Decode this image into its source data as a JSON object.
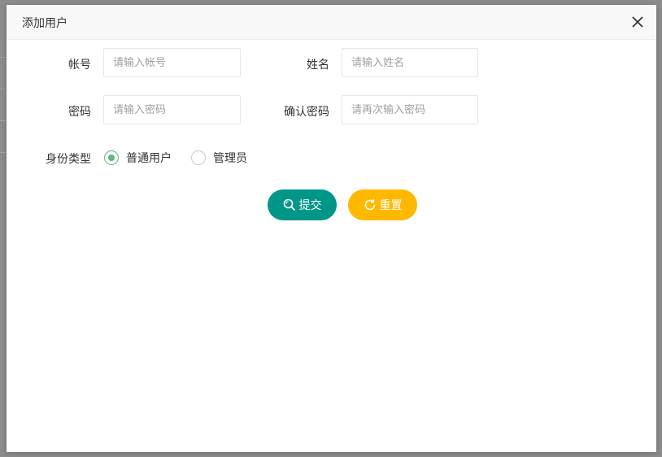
{
  "dialog": {
    "title": "添加用户",
    "close_icon": "close-icon"
  },
  "form": {
    "account": {
      "label": "帐号",
      "placeholder": "请输入帐号",
      "value": ""
    },
    "name": {
      "label": "姓名",
      "placeholder": "请输入姓名",
      "value": ""
    },
    "password": {
      "label": "密码",
      "placeholder": "请输入密码",
      "value": ""
    },
    "confirm_password": {
      "label": "确认密码",
      "placeholder": "请再次输入密码",
      "value": ""
    },
    "role": {
      "label": "身份类型",
      "options": [
        {
          "label": "普通用户",
          "checked": true
        },
        {
          "label": "管理员",
          "checked": false
        }
      ]
    }
  },
  "actions": {
    "submit_label": "提交",
    "submit_icon": "search-icon",
    "reset_label": "重置",
    "reset_icon": "refresh-icon"
  },
  "colors": {
    "submit": "#009688",
    "reset": "#ffb800",
    "radio_checked": "#5fb878"
  }
}
